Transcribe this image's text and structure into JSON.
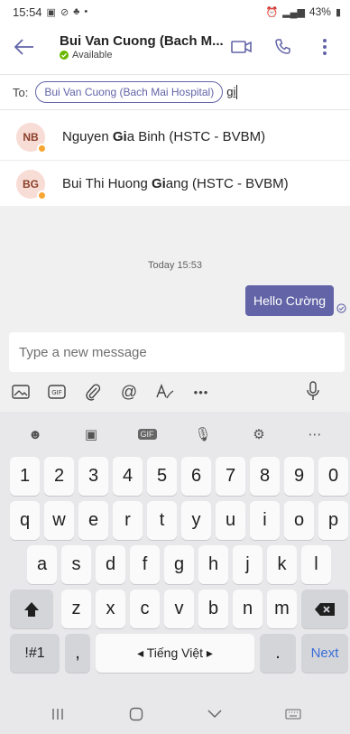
{
  "status": {
    "time": "15:54",
    "battery": "43%"
  },
  "header": {
    "title": "Bui Van Cuong (Bach M...",
    "presence": "Available"
  },
  "to_row": {
    "label": "To:",
    "chip": "Bui Van Cuong (Bach Mai Hospital)",
    "typed": "gi"
  },
  "suggestions": [
    {
      "initials": "NB",
      "name_before": "Nguyen ",
      "name_match": "Gi",
      "name_after": "a Binh (HSTC - BVBM)"
    },
    {
      "initials": "BG",
      "name_before": "Bui Thi  Huong ",
      "name_match": "Gi",
      "name_after": "ang (HSTC - BVBM)"
    }
  ],
  "chat": {
    "date": "Today 15:53",
    "message": "Hello Cường"
  },
  "composer": {
    "placeholder": "Type a new message",
    "more": "•••"
  },
  "keyboard": {
    "numbers": [
      "1",
      "2",
      "3",
      "4",
      "5",
      "6",
      "7",
      "8",
      "9",
      "0"
    ],
    "row1": [
      "q",
      "w",
      "e",
      "r",
      "t",
      "y",
      "u",
      "i",
      "o",
      "p"
    ],
    "row2": [
      "a",
      "s",
      "d",
      "f",
      "g",
      "h",
      "j",
      "k",
      "l"
    ],
    "row3": [
      "z",
      "x",
      "c",
      "v",
      "b",
      "n",
      "m"
    ],
    "symbols": "!#1",
    "comma": ",",
    "space": "◂ Tiếng Việt ▸",
    "period": ".",
    "next": "Next"
  },
  "colors": {
    "accent": "#6264a7",
    "available": "#6bb700",
    "away": "#f8a531"
  }
}
